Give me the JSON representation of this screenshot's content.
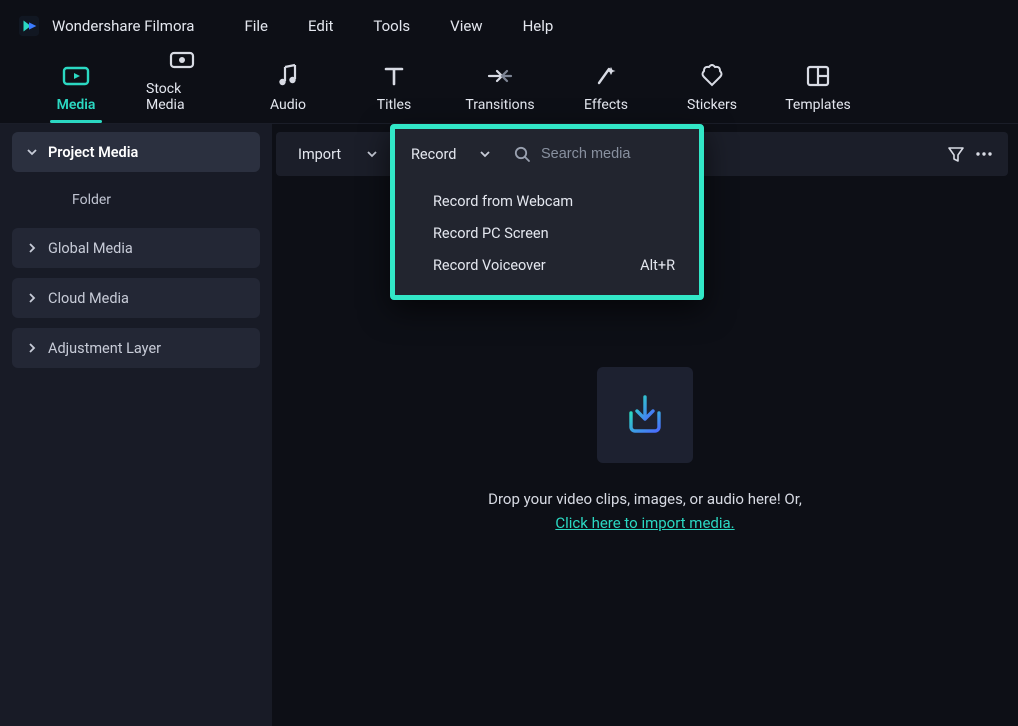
{
  "app": {
    "name": "Wondershare Filmora"
  },
  "menubar": {
    "file": "File",
    "edit": "Edit",
    "tools": "Tools",
    "view": "View",
    "help": "Help"
  },
  "toolbar": {
    "media": "Media",
    "stock_media": "Stock Media",
    "audio": "Audio",
    "titles": "Titles",
    "transitions": "Transitions",
    "effects": "Effects",
    "stickers": "Stickers",
    "templates": "Templates"
  },
  "sidebar": {
    "project_media": "Project Media",
    "folder": "Folder",
    "global_media": "Global Media",
    "cloud_media": "Cloud Media",
    "adjustment_layer": "Adjustment Layer"
  },
  "controls": {
    "import": "Import",
    "record": "Record",
    "search_placeholder": "Search media"
  },
  "record_menu": {
    "webcam": "Record from Webcam",
    "pc_screen": "Record PC Screen",
    "voiceover": "Record Voiceover",
    "voiceover_shortcut": "Alt+R"
  },
  "dropzone": {
    "line1": "Drop your video clips, images, or audio here! Or,",
    "link": "Click here to import media."
  }
}
